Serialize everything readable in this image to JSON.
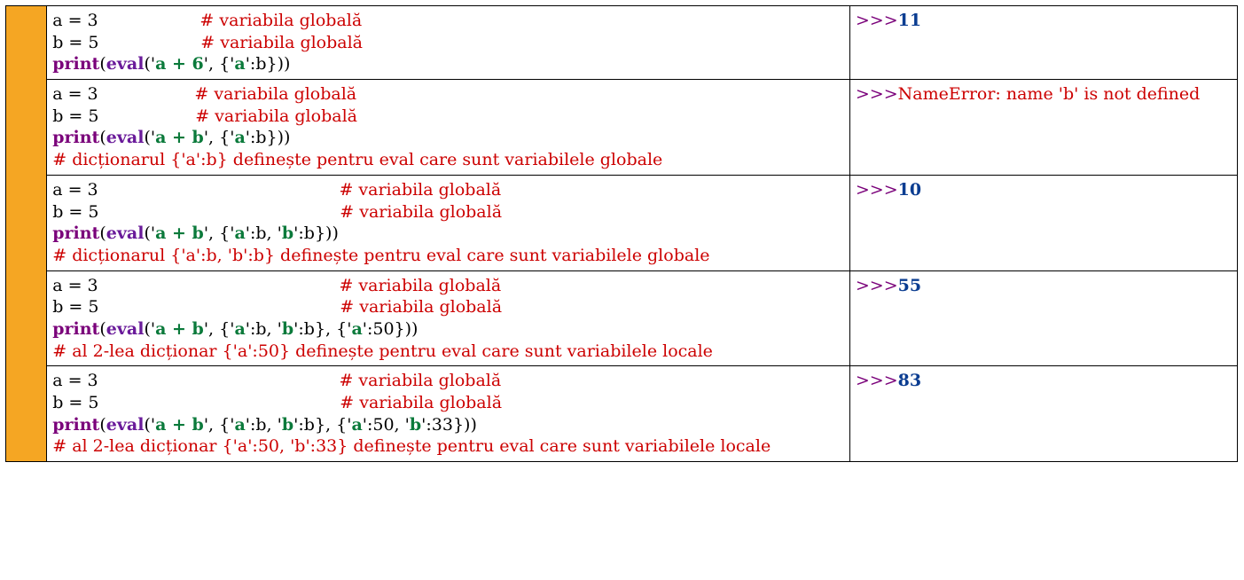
{
  "rows": [
    {
      "a_line": "a = 3",
      "b_line": "b = 5",
      "a_pad": 19,
      "b_pad": 19,
      "a_comment": "# variabila globală",
      "b_comment": "# variabila globală",
      "print": "print",
      "open": "(",
      "eval": "eval",
      "open2": "('",
      "expr": "a + 6",
      "mid": "', {'",
      "dict_keys": [
        "a"
      ],
      "dict_seps": [],
      "after_key": [
        "':b}))"
      ],
      "trailing": "",
      "note": "",
      "locals": null,
      "prompt": ">>>",
      "result_num": "11",
      "result_err": null
    },
    {
      "a_line": "a = 3",
      "b_line": "b = 5",
      "a_pad": 18,
      "b_pad": 18,
      "a_comment": "# variabila globală",
      "b_comment": "# variabila globală",
      "print": "print",
      "open": "(",
      "eval": "eval",
      "open2": "('",
      "expr": "a + b",
      "mid": "', {'",
      "dict_keys": [
        "a"
      ],
      "dict_seps": [],
      "after_key": [
        "':b}))"
      ],
      "trailing": "",
      "note": "# dicționarul {'a':b} definește pentru eval care sunt variabilele globale",
      "locals": null,
      "prompt": ">>>",
      "result_num": null,
      "result_err": "NameError: name 'b' is not defined"
    },
    {
      "a_line": "a = 3",
      "b_line": "b = 5",
      "a_pad": 45,
      "b_pad": 45,
      "a_comment": "# variabila globală",
      "b_comment": "# variabila globală",
      "print": "print",
      "open": "(",
      "eval": "eval",
      "open2": "('",
      "expr": "a + b",
      "mid": "', {'",
      "dict_keys": [
        "a",
        "b"
      ],
      "dict_seps": [
        "':b, '"
      ],
      "after_key": [
        "':b}))"
      ],
      "trailing": "",
      "note": "# dicționarul {'a':b, 'b':b} definește pentru eval care sunt variabilele globale",
      "locals": null,
      "prompt": ">>>",
      "result_num": "10",
      "result_err": null
    },
    {
      "a_line": "a = 3",
      "b_line": "b = 5",
      "a_pad": 45,
      "b_pad": 45,
      "a_comment": "# variabila globală",
      "b_comment": "# variabila globală",
      "print": "print",
      "open": "(",
      "eval": "eval",
      "open2": "('",
      "expr": "a + b",
      "mid": "', {'",
      "dict_keys": [
        "a",
        "b"
      ],
      "dict_seps": [
        "':b, '"
      ],
      "after_key": [
        "':b}, {'"
      ],
      "trailing": "",
      "note": "# al 2-lea dicționar {'a':50} definește pentru eval care sunt variabilele locale",
      "locals": {
        "keys": [
          "a"
        ],
        "seps": [],
        "after": [
          "':50}))"
        ]
      },
      "prompt": ">>>",
      "result_num": "55",
      "result_err": null
    },
    {
      "a_line": "a = 3",
      "b_line": "b = 5",
      "a_pad": 45,
      "b_pad": 45,
      "a_comment": "# variabila globală",
      "b_comment": "# variabila globală",
      "print": "print",
      "open": "(",
      "eval": "eval",
      "open2": "('",
      "expr": "a + b",
      "mid": "', {'",
      "dict_keys": [
        "a",
        "b"
      ],
      "dict_seps": [
        "':b, '"
      ],
      "after_key": [
        "':b}, {'"
      ],
      "trailing": "",
      "note": "# al 2-lea dicționar {'a':50, 'b':33} definește pentru eval care sunt variabilele locale",
      "locals": {
        "keys": [
          "a",
          "b"
        ],
        "seps": [
          "':50, '"
        ],
        "after": [
          "':33}))"
        ]
      },
      "prompt": ">>>",
      "result_num": "83",
      "result_err": null
    }
  ]
}
